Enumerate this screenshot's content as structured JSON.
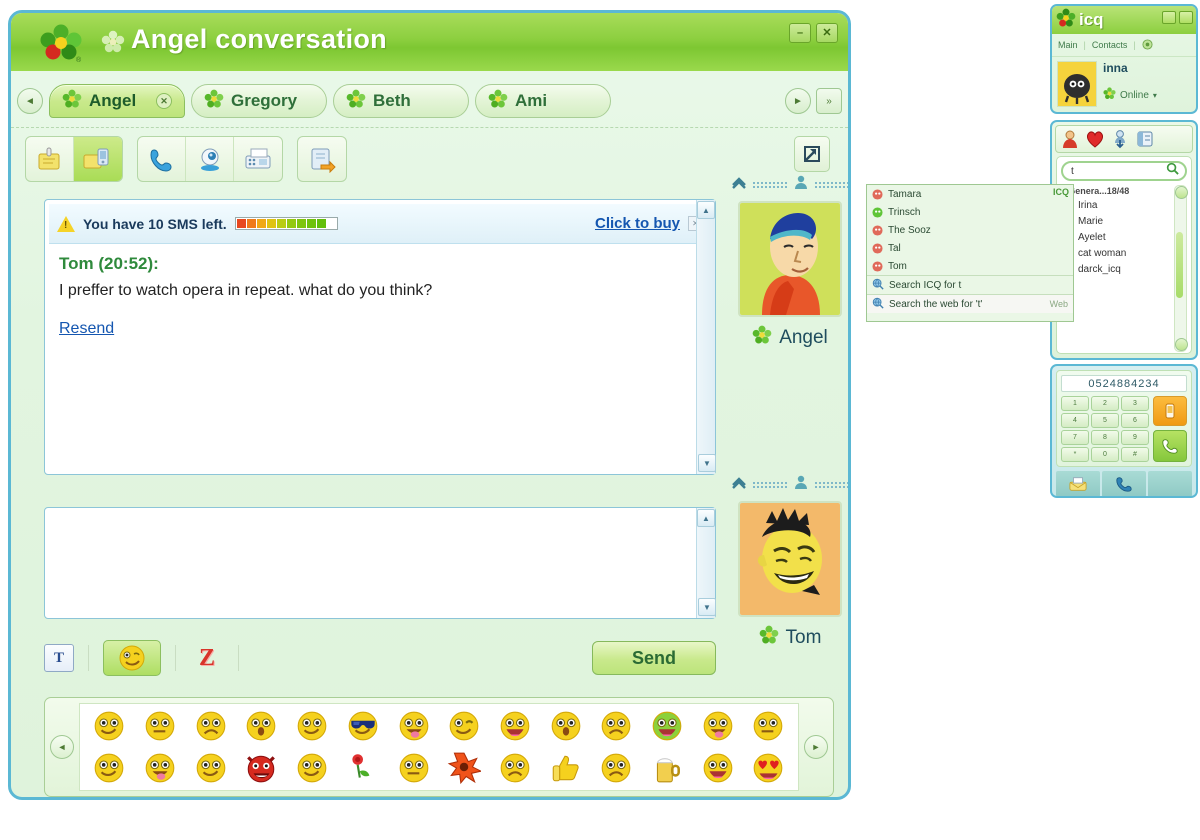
{
  "window": {
    "title": "Angel conversation",
    "logo_icon": "icq-flower-icon",
    "minimize_label": "–",
    "close_label": "✕",
    "minimize_icon": "minimize-icon",
    "close_icon": "close-icon"
  },
  "tabs": {
    "prev_arrow": "◄",
    "next_arrow": "►",
    "overflow": "»",
    "items": [
      {
        "label": "Angel",
        "active": true,
        "close": "✕"
      },
      {
        "label": "Gregory",
        "active": false
      },
      {
        "label": "Beth",
        "active": false
      },
      {
        "label": "Ami",
        "active": false
      }
    ]
  },
  "toolbar": {
    "groups": [
      [
        {
          "icon": "message-note-icon",
          "active": false
        },
        {
          "icon": "sms-icon",
          "active": true
        }
      ],
      [
        {
          "icon": "phone-icon",
          "active": false
        },
        {
          "icon": "webcam-icon",
          "active": false
        },
        {
          "icon": "fax-icon",
          "active": false
        }
      ],
      [
        {
          "icon": "send-file-icon",
          "active": false
        }
      ]
    ],
    "popout_icon": "popout-arrow-icon"
  },
  "sms_banner": {
    "warning_icon": "warning-triangle-icon",
    "text": "You have 10 SMS left.",
    "buy_link": "Click to buy",
    "close_label": "✕",
    "segments_total": 10,
    "segments_filled": 9,
    "segment_colors": [
      "#e8481f",
      "#ef7a1a",
      "#f0a815",
      "#dfc312",
      "#b9cc12",
      "#93c90f",
      "#7ec50d",
      "#6fc20c",
      "#62bf0b"
    ]
  },
  "conversation": {
    "sender": "Tom (20:52):",
    "message": "I preffer to watch opera in repeat. what do you think?",
    "resend_link": "Resend",
    "scroll_up": "▲",
    "scroll_down": "▼"
  },
  "input": {
    "value": "",
    "placeholder": "",
    "scroll_up": "▲",
    "scroll_down": "▼"
  },
  "avatars": [
    {
      "name": "Angel",
      "icon": "avatar-angel",
      "status_icon": "icq-flower-icon"
    },
    {
      "name": "Tom",
      "icon": "avatar-tom",
      "status_icon": "icq-flower-icon"
    }
  ],
  "bottom_bar": {
    "format_label": "T",
    "format_icon": "text-format-icon",
    "smiley_icon": "smiley-icon",
    "z_label": "Z",
    "z_icon": "zoom-emoticon-icon",
    "send_label": "Send"
  },
  "emoticons": {
    "prev_arrow": "◄",
    "next_arrow": "►",
    "row1": [
      "smile",
      "neutral",
      "sad",
      "surprised",
      "happy",
      "sunglasses",
      "tongue-out",
      "wink-drink",
      "laugh",
      "yawn",
      "cry",
      "sick-green",
      "tongue-cheeky",
      "facepalm"
    ],
    "row2": [
      "blush",
      "kiss",
      "smile-wide",
      "devil",
      "grin",
      "rose",
      "sealed-lips",
      "explosion",
      "confused",
      "thumbs-up",
      "worried",
      "beer",
      "big-laugh",
      "heart-eyes"
    ]
  },
  "icq_panel": {
    "logo_icon": "icq-flower-icon",
    "wordmark": "icq",
    "minimize_icon": "minimize-icon",
    "close_icon": "close-icon",
    "menu": [
      "Main",
      "Contacts"
    ],
    "menu_divider": "|",
    "settings_icon": "gear-icon",
    "nickname": "inna",
    "status": "Online",
    "status_icon": "icq-flower-icon",
    "status_arrow": "▾",
    "avatar_icon": "avatar-inna-blob"
  },
  "contact_list": {
    "icons": [
      "contact-person-icon",
      "heart-icon",
      "add-contact-icon",
      "address-book-icon"
    ],
    "search_value": "t",
    "search_icon": "search-icon",
    "group_header": "<Genera...18/48",
    "group_toggle_icon": "collapse-icon",
    "items": [
      {
        "name": "Irina",
        "status": "online"
      },
      {
        "name": "Marie",
        "status": "online"
      },
      {
        "name": "Ayelet",
        "status": "offline"
      },
      {
        "name": "cat woman",
        "status": "offline"
      },
      {
        "name": "darck_icq",
        "status": "offline"
      }
    ],
    "scroll_up_icon": "scroll-up-icon",
    "scroll_down_icon": "scroll-down-icon"
  },
  "suggest_popup": {
    "badge": "ICQ",
    "contacts": [
      {
        "label": "Tamara",
        "avatar": "red"
      },
      {
        "label": "Trinsch",
        "avatar": "green"
      },
      {
        "label": "The Sooz",
        "avatar": "red"
      },
      {
        "label": "Tal",
        "avatar": "red"
      },
      {
        "label": "Tom",
        "avatar": "red"
      }
    ],
    "search_icq": "Search ICQ for t",
    "search_web": "Search the web for 't'",
    "web_tag": "Web",
    "search_icon": "search-globe-icon"
  },
  "dialer": {
    "number": "0524884234",
    "keys": [
      "1",
      "2",
      "3",
      "4",
      "5",
      "6",
      "7",
      "8",
      "9",
      "*",
      "0",
      "#"
    ],
    "hangup_icon": "hangup-icon",
    "call_icon": "call-icon",
    "foot_icons": [
      "voicemail-icon",
      "phone-icon",
      "blank-icon"
    ]
  },
  "colors": {
    "accent_green": "#8ccf3f",
    "frame_blue": "#5bb8d4",
    "link_blue": "#1456b0",
    "sender_green": "#2f8a3c"
  }
}
